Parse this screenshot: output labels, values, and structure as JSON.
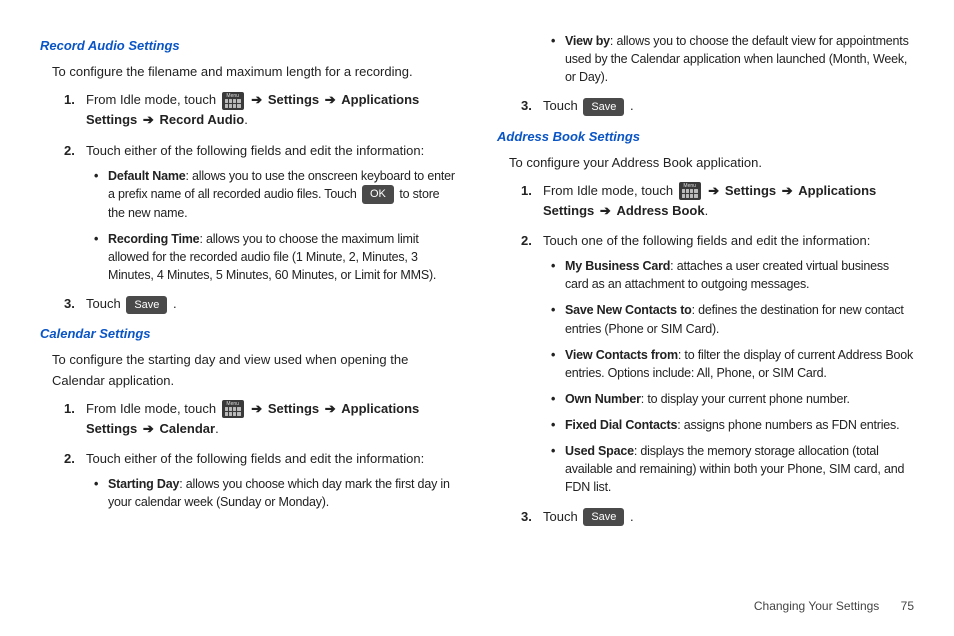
{
  "left": {
    "record_audio": {
      "title": "Record Audio Settings",
      "intro": "To configure the filename and maximum length for a recording.",
      "step1_a": "From Idle mode, touch ",
      "step1_b": " Settings",
      "step1_c": " Applications Settings",
      "step1_d": " Record Audio",
      "step1_e": ".",
      "step2": "Touch either of the following fields and edit the information:",
      "bullet1_term": "Default Name",
      "bullet1_a": ": allows you to use the onscreen keyboard to enter a prefix name of all recorded audio files. Touch ",
      "bullet1_b": " to store the new name.",
      "bullet2_term": "Recording Time",
      "bullet2_text": ": allows you to choose the maximum limit allowed for the recorded audio file (1 Minute, 2, Minutes, 3 Minutes, 4 Minutes, 5 Minutes, 60 Minutes, or Limit for MMS).",
      "step3_a": "Touch ",
      "step3_b": "."
    },
    "calendar": {
      "title": "Calendar Settings",
      "intro": "To configure the starting day and view used when opening the Calendar application.",
      "step1_a": "From Idle mode, touch ",
      "step1_b": " Settings",
      "step1_c": " Applications Settings",
      "step1_d": " Calendar",
      "step1_e": ".",
      "step2": "Touch either of the following fields and edit the information:",
      "bullet1_term": "Starting Day",
      "bullet1_text": ": allows you choose which day mark the first day in your calendar week (Sunday or Monday)."
    }
  },
  "right": {
    "calendar_cont": {
      "bullet_term": "View by",
      "bullet_text": ": allows you to choose the default view for appointments used by the Calendar application when launched (Month, Week, or Day).",
      "step3_a": "Touch ",
      "step3_b": "."
    },
    "address_book": {
      "title": "Address Book Settings",
      "intro": "To configure your Address Book application.",
      "step1_a": "From Idle mode, touch ",
      "step1_b": " Settings",
      "step1_c": " Applications Settings",
      "step1_d": " Address Book",
      "step1_e": ".",
      "step2": "Touch one of the following fields and edit the information:",
      "b1_term": "My Business Card",
      "b1_text": ": attaches a user created virtual business card as an attachment to outgoing messages.",
      "b2_term": "Save New Contacts to",
      "b2_text": ": defines the destination for new contact entries (Phone or SIM Card).",
      "b3_term": "View Contacts from",
      "b3_text": ": to filter the display of current Address Book entries. Options include: All, Phone, or SIM Card.",
      "b4_term": "Own Number",
      "b4_text": ": to display your current phone number.",
      "b5_term": "Fixed Dial Contacts",
      "b5_text": ": assigns phone numbers as FDN entries.",
      "b6_term": "Used Space",
      "b6_text": ": displays the memory storage allocation (total available and remaining) within both your Phone, SIM card, and FDN list.",
      "step3_a": "Touch ",
      "step3_b": "."
    }
  },
  "buttons": {
    "ok": "OK",
    "save": "Save"
  },
  "arrow": "➔",
  "footer": {
    "section": "Changing Your Settings",
    "page": "75"
  }
}
